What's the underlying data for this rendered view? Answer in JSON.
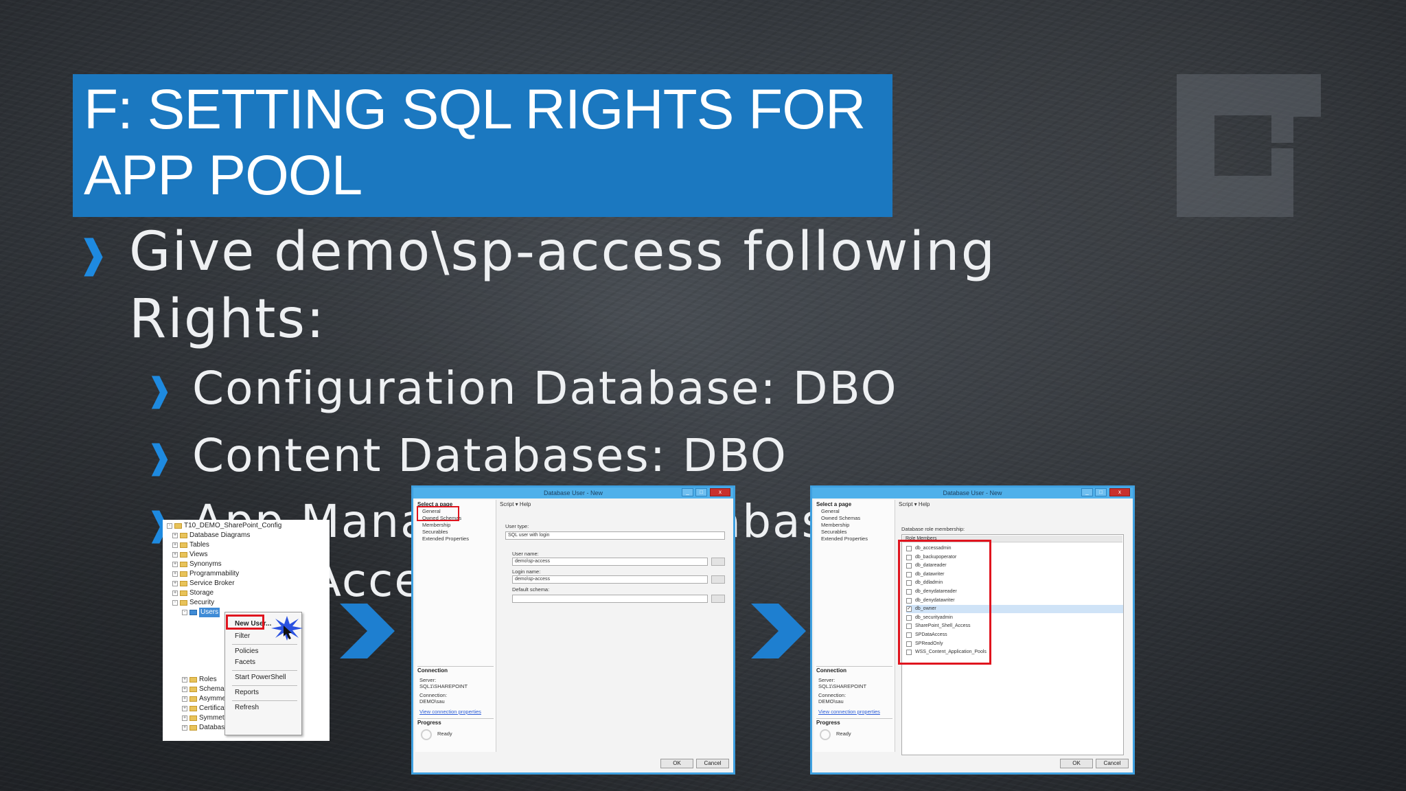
{
  "slide": {
    "title_line1": "F: SETTING SQL RIGHTS FOR",
    "title_line2": "APP POOL",
    "accent_color": "#1b78c0",
    "bullet_marker": "❱",
    "bullets": [
      {
        "text": "Give demo\\sp-access following"
      },
      {
        "text": "Rights:"
      }
    ],
    "sub_bullets": [
      {
        "text": "Configuration Database: DBO"
      },
      {
        "text": "Content Databases: DBO"
      },
      {
        "text": "App Management Database:"
      },
      {
        "text": "MetaAccess"
      }
    ]
  },
  "object_explorer": {
    "rows": [
      {
        "label": "T10_DEMO_SharePoint_Config",
        "toggle": "-"
      },
      {
        "label": "Database Diagrams",
        "toggle": "+"
      },
      {
        "label": "Tables",
        "toggle": "+"
      },
      {
        "label": "Views",
        "toggle": "+"
      },
      {
        "label": "Synonyms",
        "toggle": "+"
      },
      {
        "label": "Programmability",
        "toggle": "+"
      },
      {
        "label": "Service Broker",
        "toggle": "+"
      },
      {
        "label": "Storage",
        "toggle": "+"
      },
      {
        "label": "Security",
        "toggle": "-"
      },
      {
        "label": "Users",
        "toggle": "-"
      }
    ],
    "lower_rows": [
      {
        "label": "Roles",
        "toggle": "+"
      },
      {
        "label": "Schemas",
        "toggle": "+"
      },
      {
        "label": "Asymmetric Keys",
        "toggle": "+"
      },
      {
        "label": "Certificates",
        "toggle": "+"
      },
      {
        "label": "Symmetric Keys",
        "toggle": "+"
      },
      {
        "label": "Database Audit Specifications",
        "toggle": "+"
      }
    ],
    "context_menu": [
      "New User...",
      "Filter",
      "Policies",
      "Facets",
      "Start PowerShell",
      "Reports",
      "Refresh"
    ]
  },
  "dialog1": {
    "title": "Database User - New",
    "select_page": "Select a page",
    "pages": [
      "General",
      "Owned Schemas",
      "Membership",
      "Securables",
      "Extended Properties"
    ],
    "toolbar": "Script  ▾  Help",
    "user_type_label": "User type:",
    "user_type_value": "SQL user with login",
    "user_name_label": "User name:",
    "user_name_value": "demo\\sp-access",
    "login_name_label": "Login name:",
    "login_name_value": "demo\\sp-access",
    "default_schema_label": "Default schema:",
    "connection_hdr": "Connection",
    "server_label": "Server:",
    "server_value": "SQL1\\SHAREPOINT",
    "connection_label": "Connection:",
    "connection_value": "DEMO\\sau",
    "view_props": "View connection properties",
    "progress_hdr": "Progress",
    "ready": "Ready",
    "ok": "OK",
    "cancel": "Cancel"
  },
  "dialog2": {
    "title": "Database User - New",
    "select_page": "Select a page",
    "pages": [
      "General",
      "Owned Schemas",
      "Membership",
      "Securables",
      "Extended Properties"
    ],
    "toolbar": "Script  ▾  Help",
    "role_membership_label": "Database role membership:",
    "role_col_header": "Role Members",
    "roles": [
      {
        "name": "db_accessadmin",
        "checked": false
      },
      {
        "name": "db_backupoperator",
        "checked": false
      },
      {
        "name": "db_datareader",
        "checked": false
      },
      {
        "name": "db_datawriter",
        "checked": false
      },
      {
        "name": "db_ddladmin",
        "checked": false
      },
      {
        "name": "db_denydatareader",
        "checked": false
      },
      {
        "name": "db_denydatawriter",
        "checked": false
      },
      {
        "name": "db_owner",
        "checked": true
      },
      {
        "name": "db_securityadmin",
        "checked": false
      },
      {
        "name": "SharePoint_Shell_Access",
        "checked": false
      },
      {
        "name": "SPDataAccess",
        "checked": false
      },
      {
        "name": "SPReadOnly",
        "checked": false
      },
      {
        "name": "WSS_Content_Application_Pools",
        "checked": false
      }
    ],
    "connection_hdr": "Connection",
    "server_label": "Server:",
    "server_value": "SQL1\\SHAREPOINT",
    "connection_label": "Connection:",
    "connection_value": "DEMO\\sau",
    "view_props": "View connection properties",
    "progress_hdr": "Progress",
    "ready": "Ready",
    "ok": "OK",
    "cancel": "Cancel"
  }
}
